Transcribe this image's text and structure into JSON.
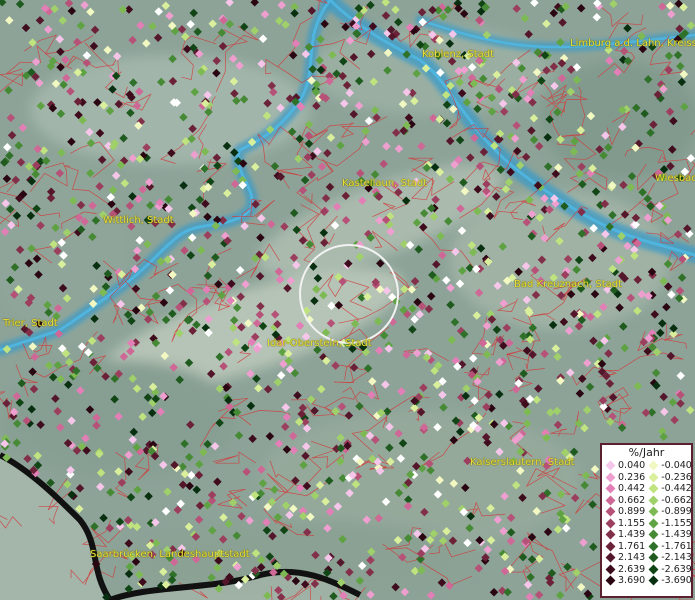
{
  "map": {
    "cities": [
      {
        "name": "Koblenz, Stadt"
      },
      {
        "name": "Limburg a.d. Lahn, Kreiss"
      },
      {
        "name": "Wiesbad"
      },
      {
        "name": "Kastellaun, Stadt"
      },
      {
        "name": "Wittlich, Stadt"
      },
      {
        "name": "Bad Kreuznach, Stadt"
      },
      {
        "name": "Trier, Stadt"
      },
      {
        "name": "Idar-Oberstein, Stadt"
      },
      {
        "name": "Kaiserslautern, Stadt"
      },
      {
        "name": "Saarbrücken, Landeshauptstadt"
      }
    ],
    "colors": {
      "terrain": "#8fa39a",
      "river": "#3d9bc6",
      "borders": "#d23a3a",
      "country_border": "#111111",
      "label": "#e8e03a"
    }
  },
  "legend": {
    "title": "%/Jahr",
    "rows": [
      {
        "pos": "0.040",
        "pos_color": "#f6c6ea",
        "neg": "-0.040",
        "neg_color": "#f2f8c2"
      },
      {
        "pos": "0.236",
        "pos_color": "#ee9fd0",
        "neg": "-0.236",
        "neg_color": "#d9ef9c"
      },
      {
        "pos": "0.442",
        "pos_color": "#e27fb6",
        "neg": "-0.442",
        "neg_color": "#bfe37e"
      },
      {
        "pos": "0.662",
        "pos_color": "#cf6897",
        "neg": "-0.662",
        "neg_color": "#9fd06a"
      },
      {
        "pos": "0.899",
        "pos_color": "#b65278",
        "neg": "-0.899",
        "neg_color": "#7eba54"
      },
      {
        "pos": "1.155",
        "pos_color": "#9c3f5e",
        "neg": "-1.155",
        "neg_color": "#5fa243"
      },
      {
        "pos": "1.439",
        "pos_color": "#82304a",
        "neg": "-1.439",
        "neg_color": "#468a35"
      },
      {
        "pos": "1.761",
        "pos_color": "#6b2238",
        "neg": "-1.761",
        "neg_color": "#30712a"
      },
      {
        "pos": "2.143",
        "pos_color": "#54162a",
        "neg": "-2.143",
        "neg_color": "#1f5a1f"
      },
      {
        "pos": "2.639",
        "pos_color": "#3e0c1d",
        "neg": "-2.639",
        "neg_color": "#124516"
      },
      {
        "pos": "3.690",
        "pos_color": "#2a0612",
        "neg": "-3.690",
        "neg_color": "#083010"
      }
    ]
  }
}
